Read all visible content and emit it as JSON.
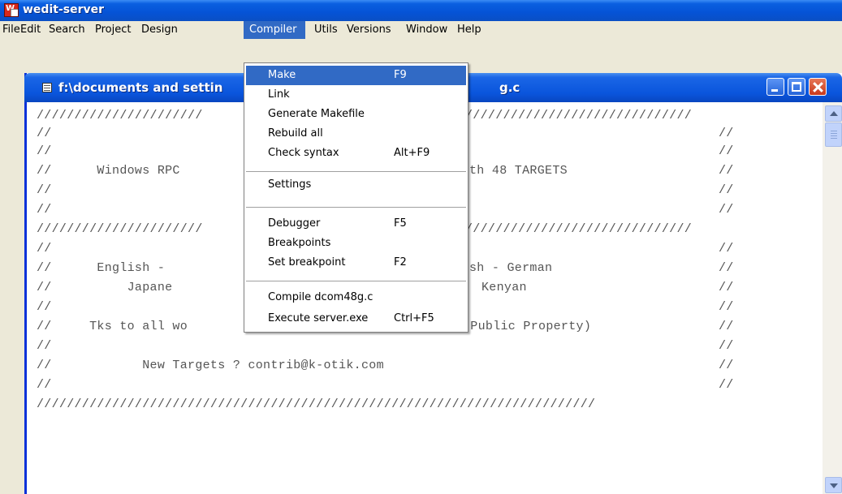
{
  "window": {
    "title": "wedit-server"
  },
  "menubar": {
    "items": [
      {
        "label": "File"
      },
      {
        "label": "Edit"
      },
      {
        "label": "Search"
      },
      {
        "label": "Project"
      },
      {
        "label": "Design"
      },
      {
        "label": "Compiler"
      },
      {
        "label": "Utils"
      },
      {
        "label": "Versions"
      },
      {
        "label": "Window"
      },
      {
        "label": "Help"
      }
    ],
    "active": "Compiler"
  },
  "child_window": {
    "title_left": "f:\\documents and settin",
    "title_right": "g.c"
  },
  "editor": {
    "lines": [
      "//////////////////////",
      "//",
      "//",
      "//      Windows RPC",
      "//",
      "//",
      "//////////////////////",
      "//",
      "//      English -",
      "//          Japane",
      "//",
      "//     Tks to all wo",
      "//",
      "//            New Targets ? contrib@k-otik.com",
      "//",
      "//////////////////////////////////////////////////////////////////////////",
      "//////////////////////////////",
      "//",
      "//",
      "th 48 TARGETS",
      "//",
      "//",
      "//////////////////////////////",
      "//",
      "sh - German",
      "//",
      "Kenyan",
      "//",
      "//",
      "(Public Property)",
      "//",
      "//",
      "//",
      "//",
      "//",
      "//",
      "//"
    ]
  },
  "compiler_menu": {
    "items": [
      {
        "label": "Make",
        "accel": "F9",
        "highlighted": true
      },
      {
        "label": "Link",
        "accel": ""
      },
      {
        "label": "Generate Makefile",
        "accel": ""
      },
      {
        "label": "Rebuild all",
        "accel": ""
      },
      {
        "label": "Check syntax",
        "accel": "Alt+F9"
      },
      {
        "label": "Settings",
        "accel": ""
      },
      {
        "label": "Debugger",
        "accel": "F5"
      },
      {
        "label": "Breakpoints",
        "accel": ""
      },
      {
        "label": "Set breakpoint",
        "accel": "F2"
      },
      {
        "label": "Compile dcom48g.c",
        "accel": ""
      },
      {
        "label": "Execute server.exe",
        "accel": "Ctrl+F5"
      }
    ]
  },
  "colors": {
    "titlebar": "#0a55dc",
    "menu_highlight": "#316ac5",
    "close_button": "#d5482b",
    "code_text": "#555555"
  },
  "icons": [
    "app-icon",
    "document-icon",
    "minimize-icon",
    "maximize-icon",
    "close-icon",
    "scroll-up-icon",
    "scroll-down-icon"
  ]
}
